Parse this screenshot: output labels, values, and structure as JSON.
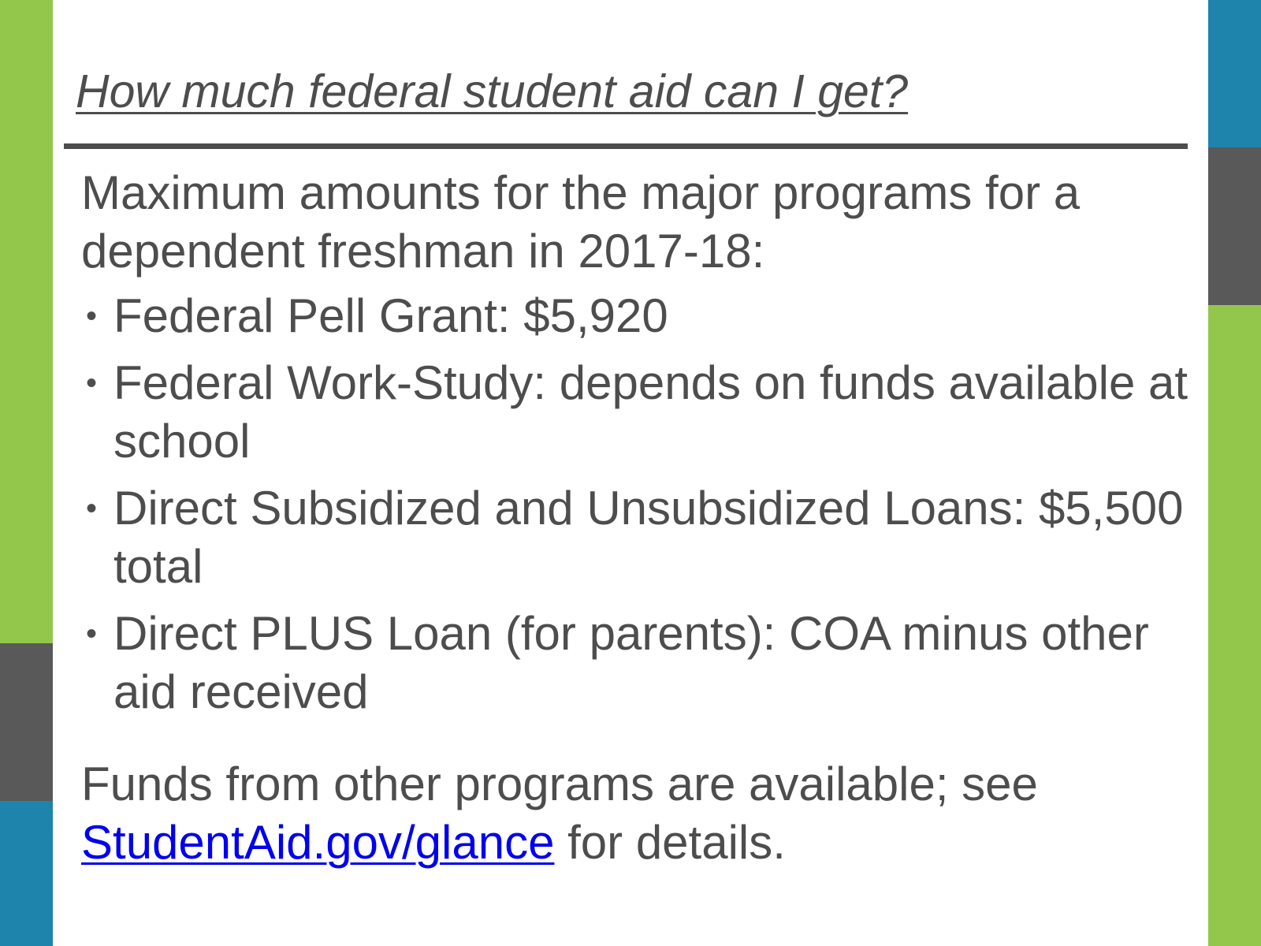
{
  "slide": {
    "title": "How much federal student aid can I get?",
    "intro": "Maximum amounts for the major programs for a dependent freshman in 2017-18:",
    "bullets": [
      "Federal Pell Grant: $5,920",
      "Federal Work-Study: depends on funds available at school",
      "Direct Subsidized and Unsubsidized Loans: $5,500 total",
      "Direct PLUS Loan (for parents): COA minus other aid received"
    ],
    "outro_before_link": "Funds from other programs are available; see",
    "link_text": "StudentAid.gov/glance",
    "outro_after_link": "for details."
  },
  "colors": {
    "accent_green": "#92c74b",
    "accent_blue": "#1e84ac",
    "accent_gray": "#595959",
    "text": "#4d4d4d",
    "link": "#0000ee"
  }
}
